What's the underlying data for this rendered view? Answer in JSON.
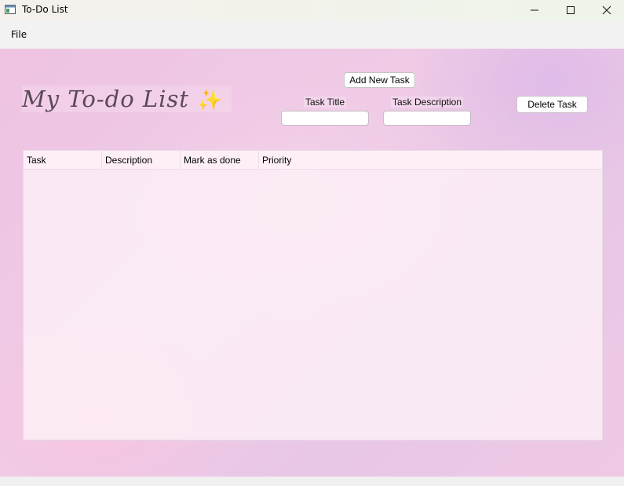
{
  "window": {
    "title": "To-Do List",
    "icon": "app-window-icon"
  },
  "menu": {
    "file": "File"
  },
  "heading": {
    "text": "My To-do List",
    "emoji": "✨"
  },
  "buttons": {
    "add_task": "Add New Task",
    "delete_task": "Delete Task"
  },
  "form": {
    "title_label": "Task Title",
    "title_value": "",
    "description_label": "Task Description",
    "description_value": ""
  },
  "table": {
    "columns": [
      "Task",
      "Description",
      "Mark as done",
      "Priority"
    ],
    "rows": []
  }
}
